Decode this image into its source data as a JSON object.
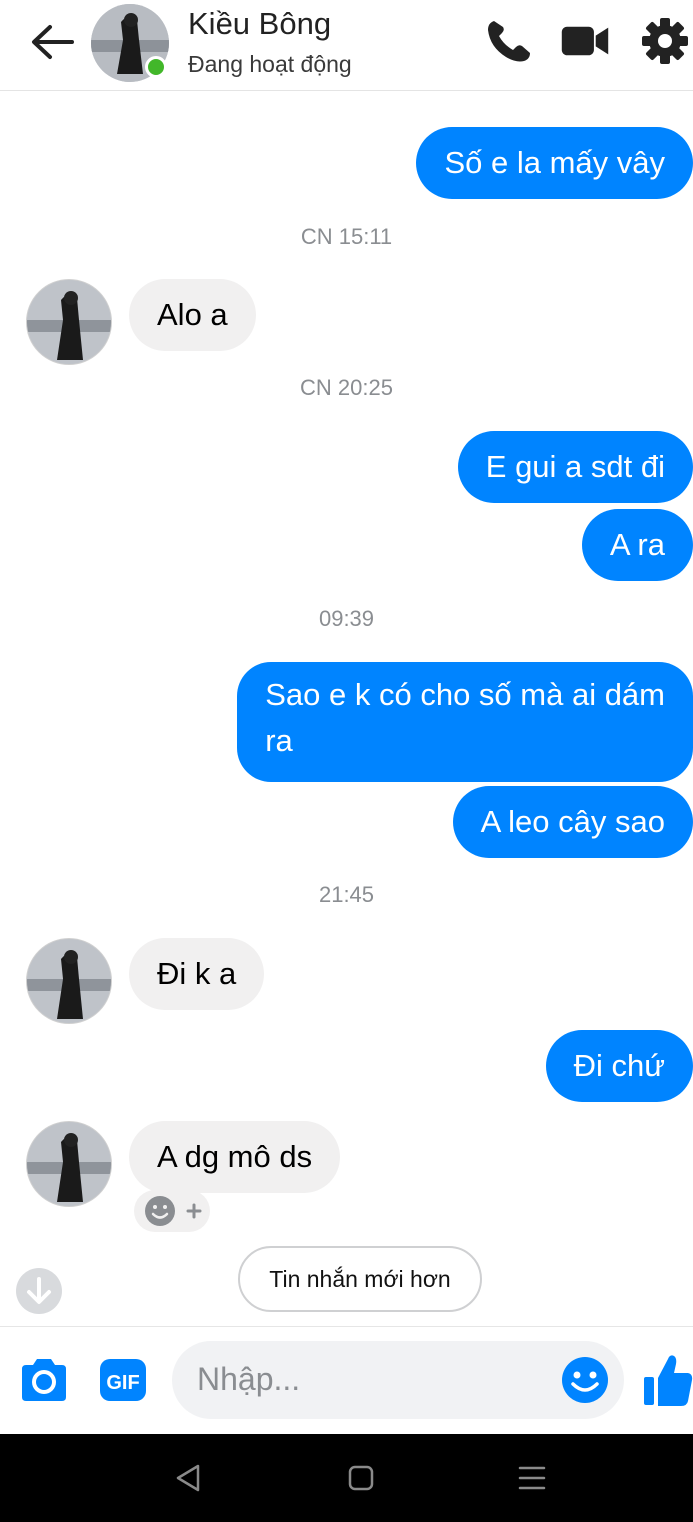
{
  "header": {
    "contact_name": "Kiều Bông",
    "status": "Đang hoạt động",
    "icons": [
      "back-arrow-icon",
      "phone-icon",
      "video-camera-icon",
      "gear-icon"
    ]
  },
  "messages": [
    {
      "type": "outgoing",
      "text": "Số e la mấy vây"
    },
    {
      "type": "timestamp",
      "text": "CN 15:11"
    },
    {
      "type": "incoming",
      "text": "Alo a"
    },
    {
      "type": "timestamp",
      "text": "CN 20:25"
    },
    {
      "type": "outgoing",
      "text": "E gui a sdt đi"
    },
    {
      "type": "outgoing",
      "text": "A ra"
    },
    {
      "type": "timestamp",
      "text": "09:39"
    },
    {
      "type": "outgoing",
      "lines": [
        "Sao e k có cho số mà ai dám",
        "ra"
      ]
    },
    {
      "type": "outgoing",
      "text": "A leo cây sao"
    },
    {
      "type": "timestamp",
      "text": "21:45"
    },
    {
      "type": "incoming",
      "text": "Đi k a"
    },
    {
      "type": "outgoing",
      "text": "Đi chứ"
    },
    {
      "type": "incoming",
      "text": "A dg mô ds"
    }
  ],
  "newer_messages_button": "Tin nhắn mới hơn",
  "composer": {
    "placeholder": "Nhập...",
    "icons": [
      "camera-icon",
      "gif-icon",
      "emoji-icon",
      "thumbs-up-icon"
    ]
  },
  "colors": {
    "accent": "#0084ff",
    "incoming_bubble": "#f1f0f0",
    "online": "#42b72a"
  }
}
